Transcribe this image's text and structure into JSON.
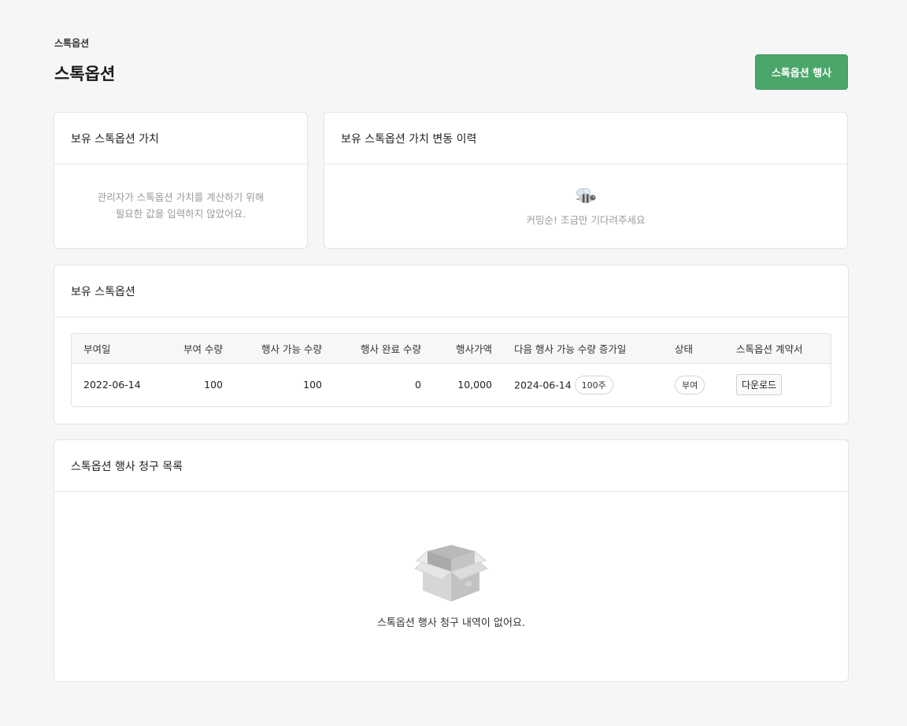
{
  "breadcrumb": "스톡옵션",
  "page_title": "스톡옵션",
  "actions": {
    "exercise_label": "스톡옵션 행사"
  },
  "value_card": {
    "title": "보유 스톡옵션 가치",
    "empty_line1": "관리자가 스톡옵션 가치를 계산하기 위해",
    "empty_line2": "필요한 값을 입력하지 않았어요."
  },
  "history_card": {
    "title": "보유 스톡옵션 가치 변동 이력",
    "icon": "bee-icon",
    "empty_text": "커밍순! 조금만 기다려주세요"
  },
  "holdings_card": {
    "title": "보유 스톡옵션",
    "columns": [
      "부여일",
      "부여 수량",
      "행사 가능 수량",
      "행사 완료 수량",
      "행사가액",
      "다음 행사 가능 수량 증가일",
      "상태",
      "스톡옵션 계약서"
    ],
    "rows": [
      {
        "grant_date": "2022-06-14",
        "granted": "100",
        "exercisable": "100",
        "exercised": "0",
        "price": "10,000",
        "next_date": "2024-06-14",
        "next_amount": "100주",
        "status": "부여",
        "contract": "다운로드"
      }
    ]
  },
  "claims_card": {
    "title": "스톡옵션 행사 청구 목록",
    "icon": "empty-box-icon",
    "empty_text": "스톡옵션 행사 청구 내역이 없어요."
  },
  "colors": {
    "primary": "#4aa66a",
    "background": "#f6f6f6"
  }
}
